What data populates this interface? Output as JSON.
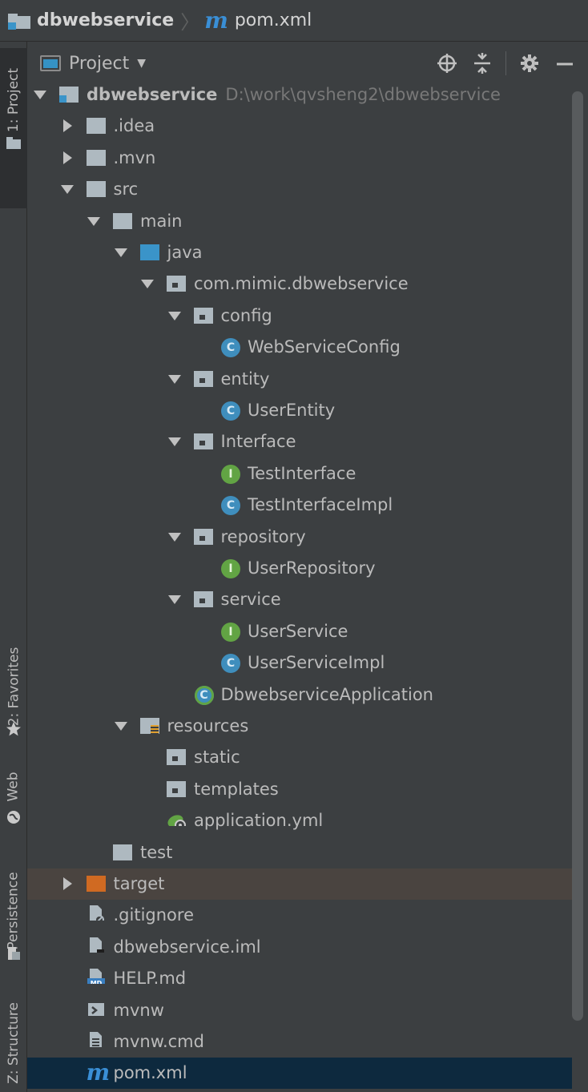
{
  "navbar": {
    "project_name": "dbwebservice",
    "file_name": "pom.xml",
    "separator": "〉",
    "maven_glyph": "m"
  },
  "toolstrip": {
    "project_tab": "1: Project",
    "favorites_tab": "2: Favorites",
    "web_tab": "Web",
    "persistence_tab": "Persistence",
    "structure_tab": "Z: Structure"
  },
  "panel": {
    "title": "Project",
    "tools": [
      "locate-icon",
      "collapse-all-icon",
      "settings-gear-icon",
      "hide-minimize-icon"
    ]
  },
  "tree": [
    {
      "label": "dbwebservice",
      "path": "D:\\work\\qvsheng2\\dbwebservice",
      "icon": "module-folder-icon",
      "expanded": true
    },
    {
      "label": ".idea",
      "icon": "folder-icon",
      "expanded": false
    },
    {
      "label": ".mvn",
      "icon": "folder-icon",
      "expanded": false
    },
    {
      "label": "src",
      "icon": "folder-icon",
      "expanded": true
    },
    {
      "label": "main",
      "icon": "folder-icon",
      "expanded": true
    },
    {
      "label": "java",
      "icon": "source-folder-icon",
      "expanded": true
    },
    {
      "label": "com.mimic.dbwebservice",
      "icon": "package-icon",
      "expanded": true
    },
    {
      "label": "config",
      "icon": "package-icon",
      "expanded": true
    },
    {
      "label": "WebServiceConfig",
      "icon": "class-icon",
      "glyph": "C"
    },
    {
      "label": "entity",
      "icon": "package-icon",
      "expanded": true
    },
    {
      "label": "UserEntity",
      "icon": "class-icon",
      "glyph": "C"
    },
    {
      "label": "Interface",
      "icon": "package-icon",
      "expanded": true
    },
    {
      "label": "TestInterface",
      "icon": "interface-icon",
      "glyph": "I"
    },
    {
      "label": "TestInterfaceImpl",
      "icon": "class-icon",
      "glyph": "C"
    },
    {
      "label": "repository",
      "icon": "package-icon",
      "expanded": true
    },
    {
      "label": "UserRepository",
      "icon": "interface-icon",
      "glyph": "I"
    },
    {
      "label": "service",
      "icon": "package-icon",
      "expanded": true
    },
    {
      "label": "UserService",
      "icon": "interface-icon",
      "glyph": "I"
    },
    {
      "label": "UserServiceImpl",
      "icon": "class-icon",
      "glyph": "C"
    },
    {
      "label": "DbwebserviceApplication",
      "icon": "spring-boot-class-icon",
      "glyph": "C"
    },
    {
      "label": "resources",
      "icon": "resources-folder-icon",
      "expanded": true
    },
    {
      "label": "static",
      "icon": "package-icon"
    },
    {
      "label": "templates",
      "icon": "package-icon"
    },
    {
      "label": "application.yml",
      "icon": "spring-config-icon"
    },
    {
      "label": "test",
      "icon": "folder-icon"
    },
    {
      "label": "target",
      "icon": "excluded-folder-icon",
      "expanded": false
    },
    {
      "label": ".gitignore",
      "icon": "ignored-file-icon"
    },
    {
      "label": "dbwebservice.iml",
      "icon": "iml-file-icon"
    },
    {
      "label": "HELP.md",
      "icon": "markdown-file-icon",
      "badge": "MD"
    },
    {
      "label": "mvnw",
      "icon": "shell-script-icon"
    },
    {
      "label": "mvnw.cmd",
      "icon": "text-file-icon"
    },
    {
      "label": "pom.xml",
      "icon": "maven-pom-icon",
      "glyph": "m",
      "selected": true
    }
  ],
  "colors": {
    "background": "#3c3f41",
    "selection": "#0d293e",
    "excluded_row": "#4a4440",
    "class_icon": "#3f8ebd",
    "interface_icon": "#62a444",
    "source_folder": "#3a94c9",
    "excluded_folder": "#d06a22"
  }
}
